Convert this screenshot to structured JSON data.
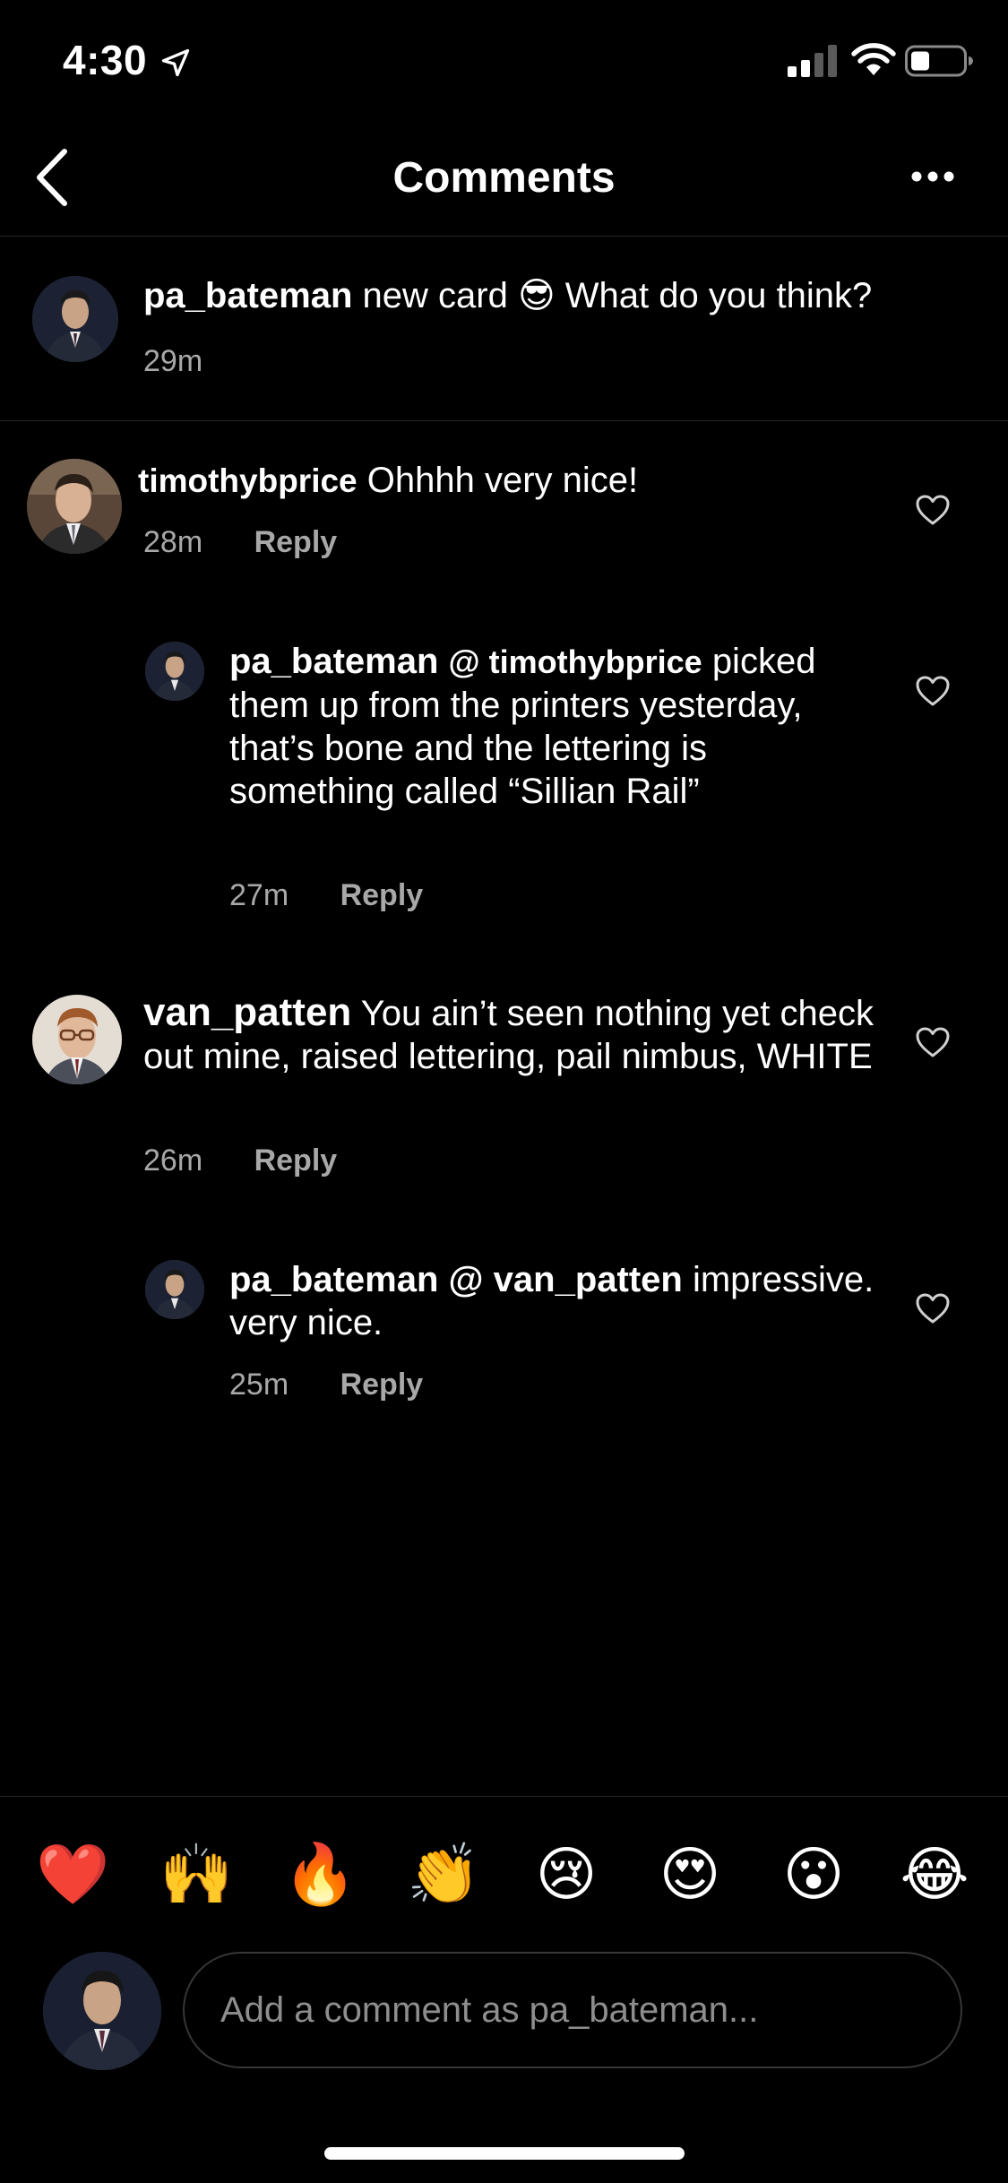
{
  "status_bar": {
    "time": "4:30"
  },
  "header": {
    "title": "Comments"
  },
  "caption": {
    "username": "pa_bateman",
    "text": "new card 😎 What do you think?",
    "time": "29m"
  },
  "comments": [
    {
      "username": "timothybprice",
      "text": "Ohhhh very nice!",
      "time": "28m",
      "reply_label": "Reply"
    },
    {
      "username": "pa_bateman",
      "mention": "@ timothybprice",
      "text": "picked them up from the printers yesterday, that’s bone and the lettering is something called “Sillian Rail”",
      "time": "27m",
      "reply_label": "Reply"
    },
    {
      "username": "van_patten",
      "text": "You ain’t seen nothing yet check out mine, raised lettering, pail nimbus, WHITE",
      "time": "26m",
      "reply_label": "Reply"
    },
    {
      "username": "pa_bateman",
      "mention": "@ van_patten",
      "text": "impressive. very nice.",
      "time": "25m",
      "reply_label": "Reply"
    }
  ],
  "emoji_bar": [
    "❤️",
    "🙌",
    "🔥",
    "👏",
    "😢",
    "😍",
    "😮",
    "😂"
  ],
  "composer": {
    "placeholder": "Add a comment as pa_bateman..."
  },
  "colors": {
    "background": "#000000",
    "text": "#ffffff",
    "secondary": "#a8a8a8",
    "divider": "#262626"
  }
}
